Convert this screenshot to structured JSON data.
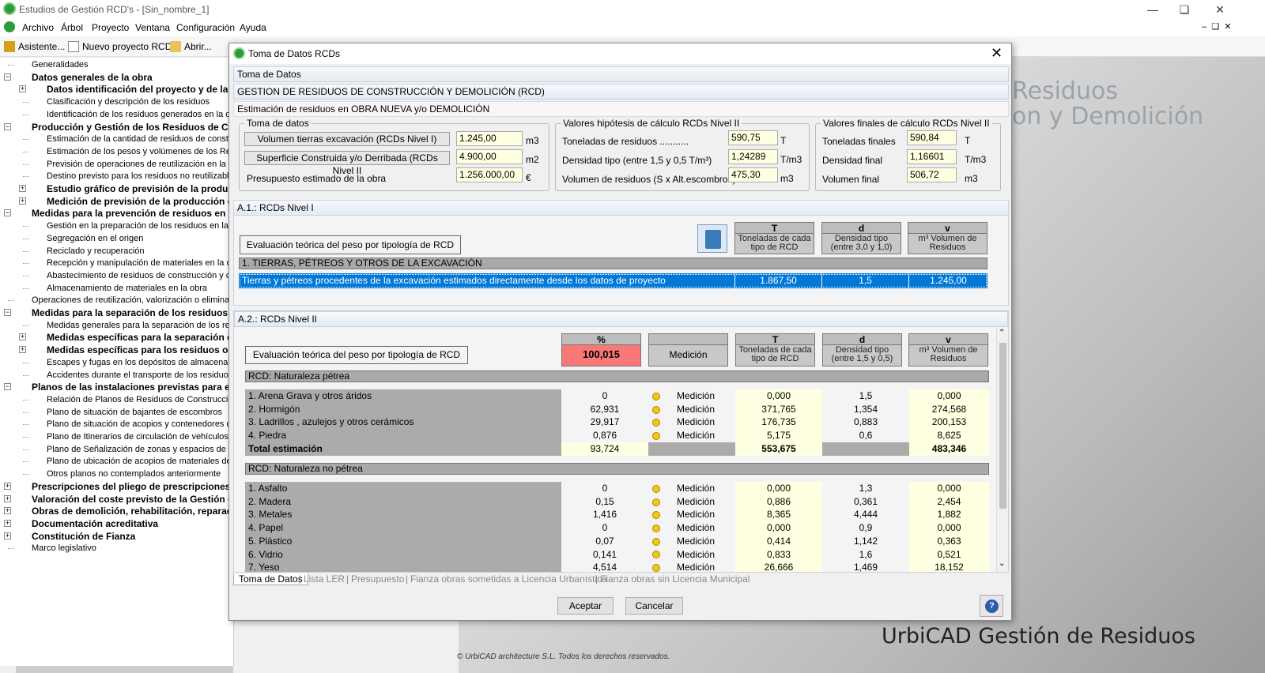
{
  "app": {
    "title": "Estudios de Gestión RCD's - [Sin_nombre_1]"
  },
  "menu": [
    "Archivo",
    "Árbol",
    "Proyecto",
    "Ventana",
    "Configuración",
    "Ayuda"
  ],
  "toolbar": {
    "asistente": "Asistente...",
    "nuevo": "Nuevo proyecto RCD",
    "abrir": "Abrir..."
  },
  "tree": [
    {
      "t": "Generalidades",
      "b": false,
      "l": 1
    },
    {
      "t": "Datos generales de la obra",
      "b": true,
      "l": 1,
      "pm": "-"
    },
    {
      "t": "Datos identificación del proyecto y de la",
      "b": true,
      "l": 2,
      "pm": "+"
    },
    {
      "t": "Clasificación y descripción de los residuos",
      "b": false,
      "l": 2
    },
    {
      "t": "Identificación de los residuos generados en la obr",
      "b": false,
      "l": 2
    },
    {
      "t": "Producción y Gestión de los Residuos de Co",
      "b": true,
      "l": 1,
      "pm": "-"
    },
    {
      "t": "Estimación de la cantidad de residuos de constru",
      "b": false,
      "l": 2
    },
    {
      "t": "Estimación de los pesos y volúmenes de los Resid",
      "b": false,
      "l": 2
    },
    {
      "t": "Previsión de operaciones de reutilización en la mis",
      "b": false,
      "l": 2
    },
    {
      "t": "Destino previsto para los residuos no reutilizables",
      "b": false,
      "l": 2
    },
    {
      "t": "Estudio gráfico de previsión de la produc",
      "b": true,
      "l": 2,
      "pm": "+"
    },
    {
      "t": "Medición de previsión de la producción d",
      "b": true,
      "l": 2,
      "pm": "+"
    },
    {
      "t": "Medidas para la prevención de residuos en l",
      "b": true,
      "l": 1,
      "pm": "-"
    },
    {
      "t": "Gestión en la preparación de los residuos en la ob",
      "b": false,
      "l": 2
    },
    {
      "t": "Segregación en el origen",
      "b": false,
      "l": 2
    },
    {
      "t": "Reciclado y recuperación",
      "b": false,
      "l": 2
    },
    {
      "t": "Recepción y manipulación de materiales en la obr",
      "b": false,
      "l": 2
    },
    {
      "t": "Abastecimiento de residuos de construcción y der",
      "b": false,
      "l": 2
    },
    {
      "t": "Almacenamiento de materiales en la obra",
      "b": false,
      "l": 2
    },
    {
      "t": "Operaciones de reutilización, valorización o eliminació",
      "b": false,
      "l": 1
    },
    {
      "t": "Medidas para la separación de los residuos e",
      "b": true,
      "l": 1,
      "pm": "-"
    },
    {
      "t": "Medidas generales para la separación de los resid",
      "b": false,
      "l": 2
    },
    {
      "t": "Medidas específicas para la separación d",
      "b": true,
      "l": 2,
      "pm": "+"
    },
    {
      "t": "Medidas específicas para los residuos oc",
      "b": true,
      "l": 2,
      "pm": "+"
    },
    {
      "t": "Escapes y fugas en los depósitos de almacenamie",
      "b": false,
      "l": 2
    },
    {
      "t": "Accidentes durante el transporte de los residuos a",
      "b": false,
      "l": 2
    },
    {
      "t": "Planos de las instalaciones previstas para el",
      "b": true,
      "l": 1,
      "pm": "-"
    },
    {
      "t": "Relación de Planos de Residuos de Construcción",
      "b": false,
      "l": 2
    },
    {
      "t": "Plano de situación de bajantes de escombros",
      "b": false,
      "l": 2
    },
    {
      "t": "Plano de situación de acopios y contenedores de",
      "b": false,
      "l": 2
    },
    {
      "t": "Plano de Itinerarios de circulación de vehículos p",
      "b": false,
      "l": 2
    },
    {
      "t": "Plano de Señalización de zonas y espacios de RC",
      "b": false,
      "l": 2
    },
    {
      "t": "Plano de ubicación de acopios de materiales de re",
      "b": false,
      "l": 2
    },
    {
      "t": "Otros planos no contemplados anteriormente",
      "b": false,
      "l": 2
    },
    {
      "t": "Prescripciones del pliego de prescripciones t",
      "b": true,
      "l": 1,
      "pm": "+"
    },
    {
      "t": "Valoración del coste previsto de la Gestión c",
      "b": true,
      "l": 1,
      "pm": "+"
    },
    {
      "t": "Obras de demolición, rehabilitación, reparaci",
      "b": true,
      "l": 1,
      "pm": "+"
    },
    {
      "t": "Documentación acreditativa",
      "b": true,
      "l": 1,
      "pm": "+"
    },
    {
      "t": "Constitución de Fianza",
      "b": true,
      "l": 1,
      "pm": "+"
    },
    {
      "t": "Marco legislativo",
      "b": false,
      "l": 1
    }
  ],
  "background": {
    "line1": "Residuos",
    "line2": "on y Demolición",
    "brand": "UrbiCAD Gestión de Residuos",
    "copyright": "© UrbiCAD architecture S.L. Todos los derechos reservados."
  },
  "dialog": {
    "title": "Toma de Datos RCDs",
    "s1": "Toma de Datos",
    "s2": "GESTION DE RESIDUOS DE CONSTRUCCIÓN Y DEMOLICIÓN (RCD)",
    "s3": "Estimación de residuos en OBRA NUEVA y/o DEMOLICIÓN",
    "toma": {
      "legend": "Toma de datos",
      "vol_label": "Volumen tierras excavación (RCDs Nivel I)",
      "vol": "1.245,00",
      "vol_unit": "m3",
      "sup_label": "Superficie Construida y/o Derribada (RCDs Nivel II",
      "sup": "4.900,00",
      "sup_unit": "m2",
      "pres_label": "Presupuesto estimado de la obra",
      "pres": "1.256.000,00",
      "pres_unit": "€"
    },
    "hip": {
      "legend": "Valores hipótesis de cálculo RCDs Nivel II",
      "t_label": "Toneladas de residuos ...........",
      "t": "590,75",
      "t_unit": "T",
      "d_label": "Densidad tipo (entre 1,5 y 0,5 T/m³)",
      "d": "1,24289",
      "d_unit": "T/m3",
      "v_label": "Volumen de residuos (S x Alt.escombros)",
      "v": "475,30",
      "v_unit": "m3"
    },
    "fin": {
      "legend": "Valores finales de cálculo RCDs Nivel II",
      "t_label": "Toneladas finales",
      "t": "590,84",
      "t_unit": "T",
      "d_label": "Densidad final",
      "d": "1,16601",
      "d_unit": "T/m3",
      "v_label": "Volumen final",
      "v": "506,72",
      "v_unit": "m3"
    },
    "a1": {
      "title": "A.1.: RCDs Nivel I",
      "eval": "Evaluación teórica del peso por tipología de RCD",
      "hT": "T",
      "hTsub": "Toneladas de cada tipo de RCD",
      "hd": "d",
      "hdsub": "Densidad tipo (entre 3,0 y 1,0)",
      "hv": "v",
      "hvsub": "m³ Volumen de Residuos",
      "cat": "1. TIERRAS, PÉTREOS Y OTROS DE LA EXCAVACIÓN",
      "row": {
        "name": "Tierras y pétreos procedentes de la excavación estimados directamente desde los datos de proyecto",
        "t": "1.867,50",
        "d": "1,5",
        "v": "1.245,00"
      }
    },
    "a2": {
      "title": "A.2.: RCDs Nivel II",
      "eval": "Evaluación teórica del peso por tipología de RCD",
      "hpct": "%",
      "pct": "100,015",
      "medicion": "Medición",
      "hT": "T",
      "hTsub": "Toneladas de cada tipo de RCD",
      "hd": "d",
      "hdsub": "Densidad tipo (entre 1,5 y 0,5)",
      "hv": "v",
      "hvsub": "m³ Volumen de Residuos",
      "cat1": "RCD: Naturaleza pétrea",
      "petrea": [
        {
          "n": "1. Arena Grava y otros áridos",
          "p": "0",
          "m": "Medición",
          "t": "0,000",
          "d": "1,5",
          "v": "0,000"
        },
        {
          "n": "2. Hormigón",
          "p": "62,931",
          "m": "Medición",
          "t": "371,765",
          "d": "1,354",
          "v": "274,568"
        },
        {
          "n": "3. Ladrillos , azulejos y otros cerámicos",
          "p": "29,917",
          "m": "Medición",
          "t": "176,735",
          "d": "0,883",
          "v": "200,153"
        },
        {
          "n": "4. Piedra",
          "p": "0,876",
          "m": "Medición",
          "t": "5,175",
          "d": "0,6",
          "v": "8,625"
        }
      ],
      "total": {
        "n": "Total estimación",
        "p": "93,724",
        "t": "553,675",
        "v": "483,346"
      },
      "cat2": "RCD: Naturaleza no pétrea",
      "nopetrea": [
        {
          "n": "1. Asfalto",
          "p": "0",
          "m": "Medición",
          "t": "0,000",
          "d": "1,3",
          "v": "0,000"
        },
        {
          "n": "2. Madera",
          "p": "0,15",
          "m": "Medición",
          "t": "0,886",
          "d": "0,361",
          "v": "2,454"
        },
        {
          "n": "3. Metales",
          "p": "1,416",
          "m": "Medición",
          "t": "8,365",
          "d": "4,444",
          "v": "1,882"
        },
        {
          "n": "4. Papel",
          "p": "0",
          "m": "Medición",
          "t": "0,000",
          "d": "0,9",
          "v": "0,000"
        },
        {
          "n": "5. Plástico",
          "p": "0,07",
          "m": "Medición",
          "t": "0,414",
          "d": "1,142",
          "v": "0,363"
        },
        {
          "n": "6. Vidrio",
          "p": "0,141",
          "m": "Medición",
          "t": "0,833",
          "d": "1,6",
          "v": "0,521"
        },
        {
          "n": "7. Yeso",
          "p": "4,514",
          "m": "Medición",
          "t": "26,666",
          "d": "1,469",
          "v": "18,152"
        }
      ]
    },
    "tabs": [
      "Toma de Datos",
      "Lista LER",
      "Presupuesto",
      "Fianza obras sometidas a Licencia Urbanística",
      "Fianza obras sin Licencia Municipal"
    ],
    "ok": "Aceptar",
    "cancel": "Cancelar"
  },
  "colors": {
    "selection": "#0078d7",
    "percent_bg": "#f87878",
    "input_bg": "#ffffe1"
  }
}
